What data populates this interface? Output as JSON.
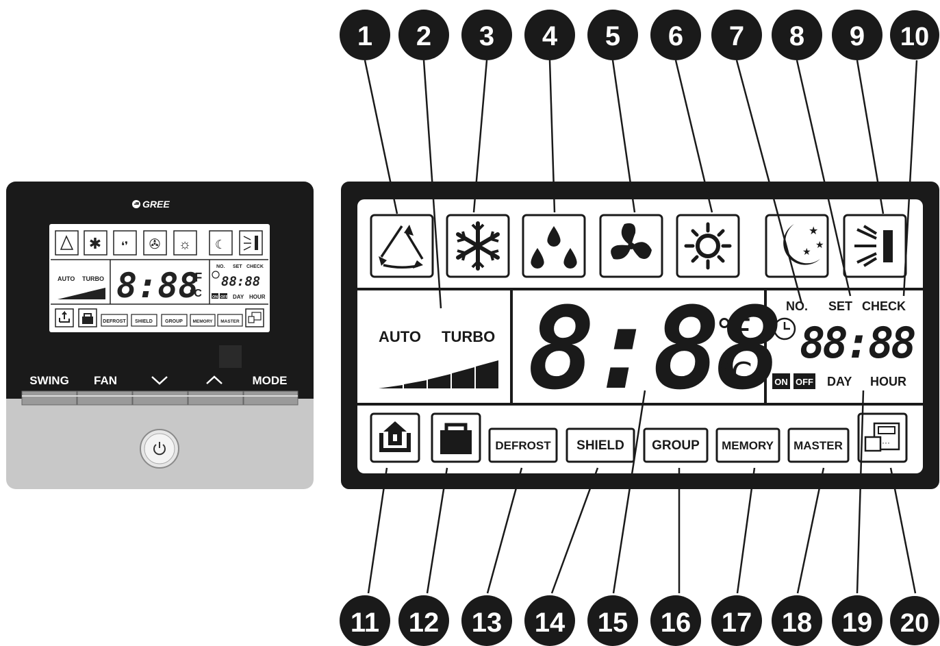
{
  "brand": "GREE",
  "small_panel": {
    "lcd": {
      "auto": "AUTO",
      "turbo": "TURBO",
      "temp_digits": "8:88",
      "unit_f": "°F",
      "unit_c": "°C",
      "no": "NO.",
      "set": "SET",
      "check": "CHECK",
      "clock_digits": "88:88",
      "on": "ON",
      "off": "OFF",
      "day": "DAY",
      "hour": "HOUR",
      "defrost": "DEFROST",
      "shield": "SHIELD",
      "group": "GROUP",
      "memory": "MEMORY",
      "master": "MASTER"
    },
    "buttons": [
      "SWING",
      "FAN",
      "",
      "",
      "MODE"
    ]
  },
  "big_lcd": {
    "auto": "AUTO",
    "turbo": "TURBO",
    "temp_digits": "8:88",
    "unit_f": "°F",
    "unit_c": "°C",
    "no": "NO.",
    "set": "SET",
    "check": "CHECK",
    "clock_digits": "88:88",
    "on": "ON",
    "off": "OFF",
    "day": "DAY",
    "hour": "HOUR",
    "defrost": "DEFROST",
    "shield": "SHIELD",
    "group": "GROUP",
    "memory": "MEMORY",
    "master": "MASTER"
  },
  "icons": [
    "auto-mode-icon",
    "cool-snowflake-icon",
    "dry-droplets-icon",
    "fan-icon",
    "heat-sun-icon",
    "sleep-moon-icon",
    "light-icon",
    "swing-icon",
    "lock-icon",
    "remote-controller-icon",
    "clock-icon",
    "power-icon"
  ],
  "callouts_top": [
    "1",
    "2",
    "3",
    "4",
    "5",
    "6",
    "7",
    "8",
    "9",
    "10"
  ],
  "callouts_bottom": [
    "11",
    "12",
    "13",
    "14",
    "15",
    "16",
    "17",
    "18",
    "19",
    "20"
  ],
  "colors": {
    "panel_black": "#1a1a1a",
    "panel_silver": "#c8c8c8",
    "lcd_bg": "#ffffff",
    "callout": "#1a1a1a"
  }
}
